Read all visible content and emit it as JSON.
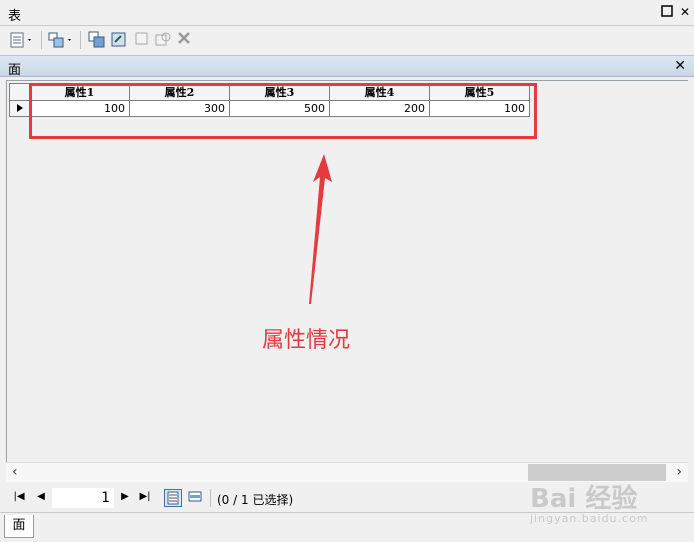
{
  "window": {
    "title": "表"
  },
  "panel": {
    "title": "面"
  },
  "table": {
    "columns": [
      "属性1",
      "属性2",
      "属性3",
      "属性4",
      "属性5"
    ],
    "rows": [
      [
        "100",
        "300",
        "500",
        "200",
        "100"
      ]
    ]
  },
  "annotation": {
    "text": "属性情况",
    "color": "#e8393e"
  },
  "navigation": {
    "page": "1",
    "selection_status": "(0 / 1 已选择)"
  },
  "bottom_tab": {
    "label": "面"
  },
  "watermark": {
    "brand": "Bai  经验",
    "url": "jingyan.baidu.com"
  },
  "icons": [
    "table-options-icon",
    "related-tables-icon",
    "select-by-attributes-icon",
    "switch-selection-icon",
    "clear-selection-icon",
    "zoom-to-selected-icon",
    "delete-selected-icon",
    "close-icon",
    "restore-icon"
  ]
}
